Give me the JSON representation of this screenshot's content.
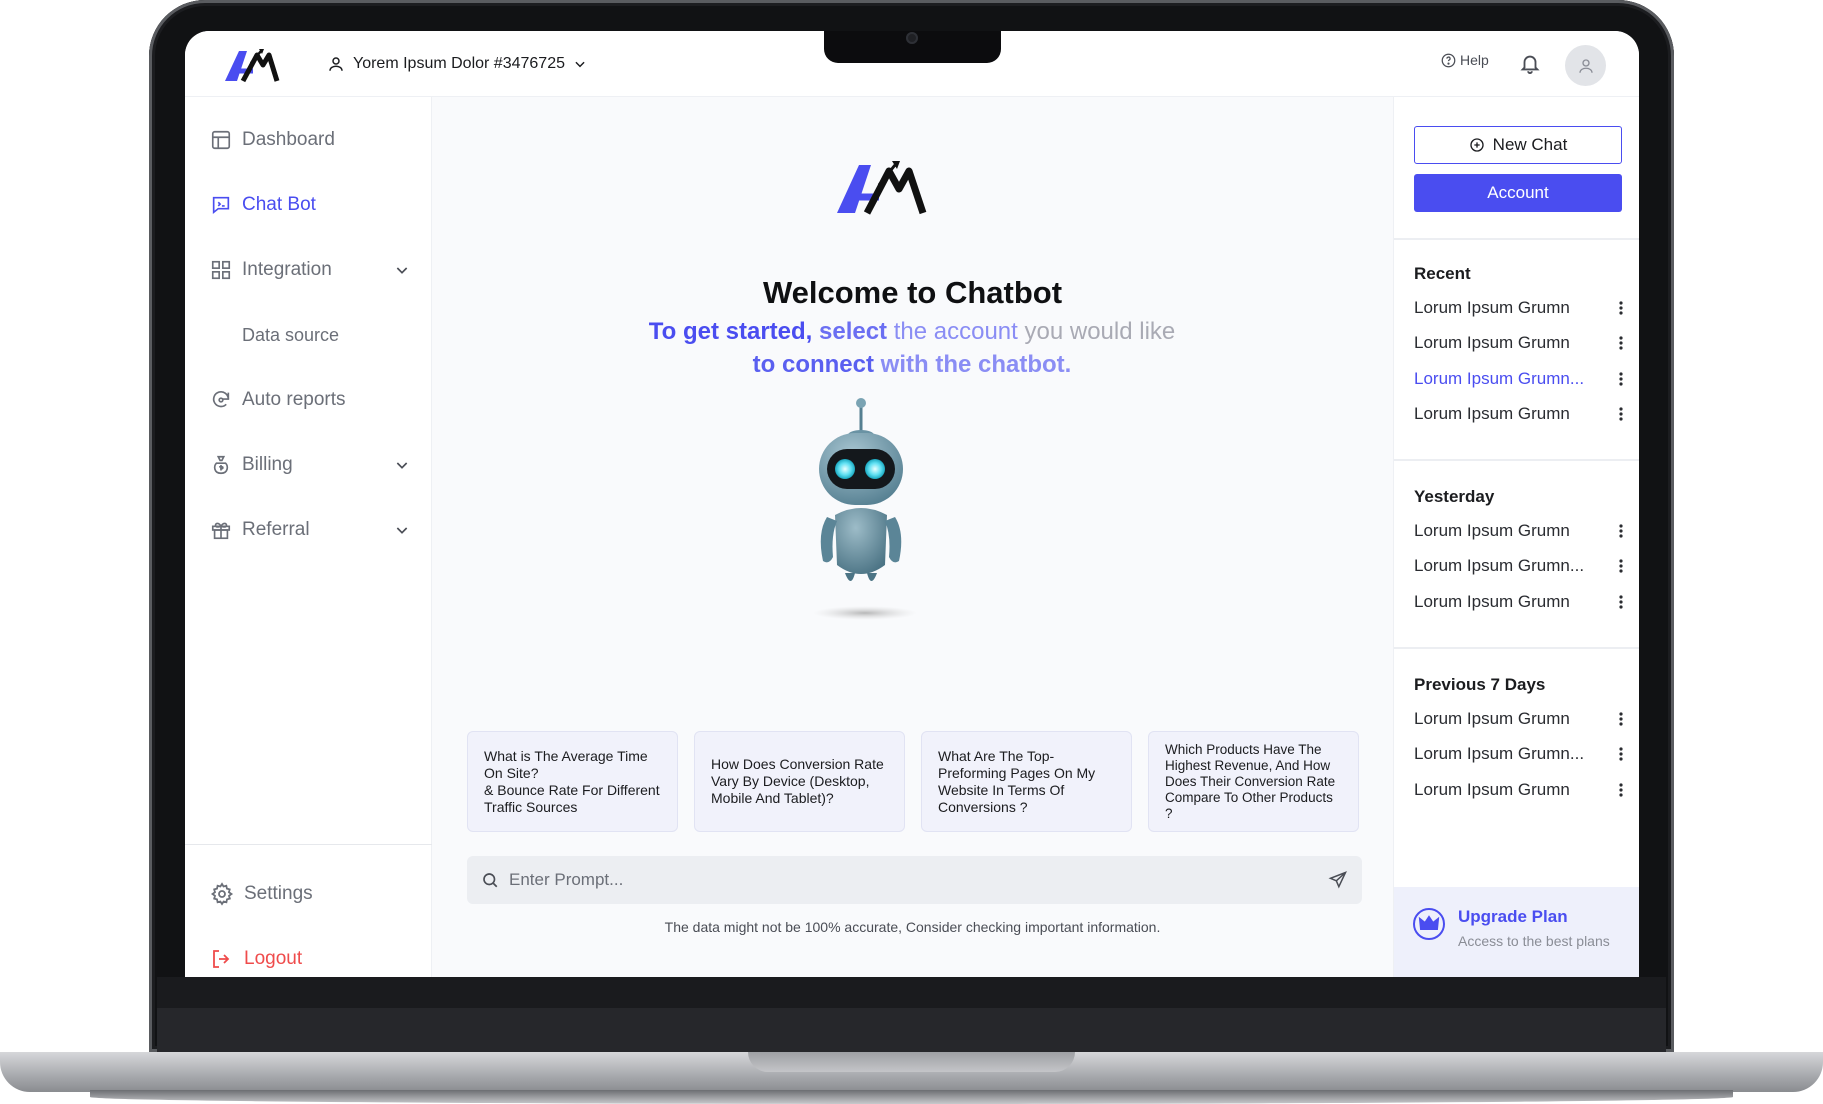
{
  "header": {
    "account_name": "Yorem Ipsum Dolor #3476725",
    "help_label": "Help"
  },
  "sidebar": {
    "items": [
      {
        "label": "Dashboard"
      },
      {
        "label": "Chat Bot"
      },
      {
        "label": "Integration"
      },
      {
        "label": "Data source"
      },
      {
        "label": "Auto reports"
      },
      {
        "label": "Billing"
      },
      {
        "label": "Referral"
      }
    ],
    "settings_label": "Settings",
    "logout_label": "Logout"
  },
  "main": {
    "welcome_title": "Welcome to Chatbot",
    "subtitle_parts": [
      "To get started,",
      "select",
      "the account",
      "you would like",
      "to connect",
      "with the chatbot."
    ],
    "suggestions": [
      "What is The Average Time On Site?\n& Bounce Rate For Different Traffic Sources",
      "How Does Conversion Rate Vary By Device (Desktop, Mobile And Tablet)?",
      "What Are The Top-Preforming Pages On My Website In Terms Of Conversions ?",
      "Which Products Have The Highest Revenue, And How Does Their Conversion Rate Compare To Other Products ?"
    ],
    "prompt_placeholder": "Enter Prompt...",
    "disclaimer": "The data might not be 100% accurate, Consider checking important information."
  },
  "right_panel": {
    "new_chat_label": "New Chat",
    "account_label": "Account",
    "groups": [
      {
        "title": "Recent",
        "items": [
          "Lorum Ipsum Grumn",
          "Lorum Ipsum Grumn",
          "Lorum Ipsum Grumn...",
          "Lorum Ipsum Grumn"
        ]
      },
      {
        "title": "Yesterday",
        "items": [
          "Lorum Ipsum Grumn",
          "Lorum Ipsum Grumn...",
          "Lorum Ipsum Grumn"
        ]
      },
      {
        "title": "Previous 7 Days",
        "items": [
          "Lorum Ipsum Grumn",
          "Lorum Ipsum Grumn...",
          "Lorum Ipsum Grumn"
        ]
      }
    ],
    "upgrade_title": "Upgrade Plan",
    "upgrade_subtitle": "Access to the best plans"
  },
  "colors": {
    "accent": "#4a4df0",
    "logout": "#ef4b4b",
    "card_bg": "#f1f2fb",
    "robot_body": "#6f9aab"
  }
}
